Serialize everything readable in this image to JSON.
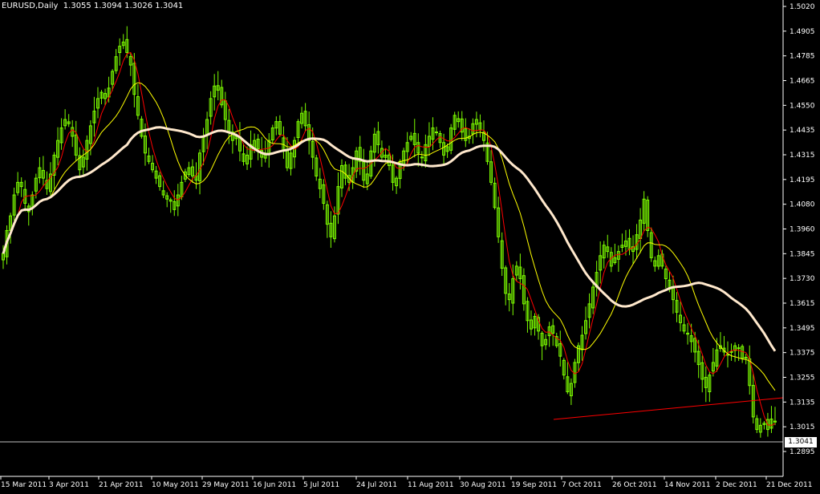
{
  "header": {
    "symbol_line": "EURUSD,Daily  1.3055 1.3094 1.3026 1.3041"
  },
  "current_price": "1.3041",
  "colors": {
    "background": "#000000",
    "candles": "#7CFC00",
    "ma_fast": "#ff0000",
    "ma_mid": "#ffff00",
    "ma_slow": "#ffe8cc",
    "trendline": "#ff0000",
    "price_line": "#c0c0c0",
    "axis": "#ffffff"
  },
  "chart_data": {
    "type": "candlestick",
    "y_ticks": [
      "1.5020",
      "1.4905",
      "1.4785",
      "1.4665",
      "1.4550",
      "1.4435",
      "1.4315",
      "1.4195",
      "1.4080",
      "1.3960",
      "1.3845",
      "1.3730",
      "1.3615",
      "1.3495",
      "1.3375",
      "1.3255",
      "1.3135",
      "1.3015",
      "1.2895"
    ],
    "x_ticks": [
      "15 Mar 2011",
      "3 Apr 2011",
      "21 Apr 2011",
      "10 May 2011",
      "29 May 2011",
      "16 Jun 2011",
      "5 Jul 2011",
      "24 Jul 2011",
      "11 Aug 2011",
      "30 Aug 2011",
      "19 Sep 2011",
      "7 Oct 2011",
      "26 Oct 2011",
      "14 Nov 2011",
      "2 Dec 2011",
      "21 Dec 2011"
    ],
    "ylim": [
      1.2895,
      1.502
    ],
    "closes": [
      1.384,
      1.395,
      1.402,
      1.412,
      1.418,
      1.416,
      1.408,
      1.404,
      1.412,
      1.42,
      1.425,
      1.42,
      1.415,
      1.422,
      1.431,
      1.438,
      1.444,
      1.448,
      1.446,
      1.44,
      1.431,
      1.424,
      1.43,
      1.438,
      1.445,
      1.452,
      1.458,
      1.461,
      1.458,
      1.463,
      1.471,
      1.478,
      1.483,
      1.485,
      1.48,
      1.474,
      1.46,
      1.45,
      1.44,
      1.432,
      1.428,
      1.424,
      1.42,
      1.416,
      1.412,
      1.41,
      1.409,
      1.405,
      1.412,
      1.418,
      1.423,
      1.425,
      1.421,
      1.419,
      1.432,
      1.44,
      1.448,
      1.458,
      1.464,
      1.462,
      1.455,
      1.448,
      1.442,
      1.438,
      1.44,
      1.433,
      1.428,
      1.431,
      1.436,
      1.438,
      1.434,
      1.43,
      1.432,
      1.438,
      1.444,
      1.447,
      1.441,
      1.433,
      1.425,
      1.432,
      1.438,
      1.447,
      1.451,
      1.445,
      1.438,
      1.43,
      1.421,
      1.415,
      1.408,
      1.398,
      1.392,
      1.402,
      1.416,
      1.426,
      1.42,
      1.418,
      1.425,
      1.433,
      1.428,
      1.419,
      1.422,
      1.433,
      1.441,
      1.436,
      1.43,
      1.431,
      1.426,
      1.418,
      1.42,
      1.428,
      1.433,
      1.437,
      1.44,
      1.436,
      1.432,
      1.43,
      1.436,
      1.44,
      1.444,
      1.442,
      1.437,
      1.431,
      1.435,
      1.444,
      1.45,
      1.447,
      1.442,
      1.438,
      1.44,
      1.446,
      1.448,
      1.443,
      1.438,
      1.428,
      1.418,
      1.406,
      1.392,
      1.377,
      1.365,
      1.362,
      1.372,
      1.378,
      1.372,
      1.36,
      1.352,
      1.348,
      1.354,
      1.347,
      1.34,
      1.343,
      1.349,
      1.346,
      1.34,
      1.335,
      1.326,
      1.318,
      1.322,
      1.332,
      1.34,
      1.345,
      1.352,
      1.36,
      1.368,
      1.375,
      1.383,
      1.388,
      1.385,
      1.378,
      1.382,
      1.385,
      1.388,
      1.39,
      1.386,
      1.385,
      1.393,
      1.4,
      1.41,
      1.395,
      1.382,
      1.378,
      1.383,
      1.378,
      1.372,
      1.367,
      1.362,
      1.356,
      1.351,
      1.347,
      1.346,
      1.342,
      1.337,
      1.331,
      1.324,
      1.32,
      1.326,
      1.332,
      1.338,
      1.34,
      1.337,
      1.336,
      1.337,
      1.34,
      1.339,
      1.334,
      1.334,
      1.321,
      1.306,
      1.3,
      1.302,
      1.303,
      1.3,
      1.305,
      1.304
    ]
  }
}
